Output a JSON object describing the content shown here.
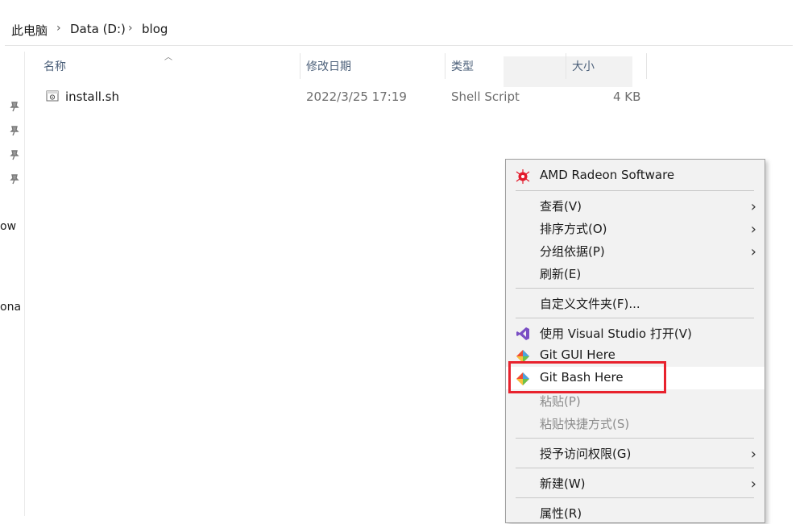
{
  "breadcrumb": {
    "items": [
      "此电脑",
      "Data (D:)",
      "blog"
    ]
  },
  "nav": {
    "fragments": [
      "ow",
      "ona"
    ]
  },
  "columns": {
    "name": "名称",
    "modified": "修改日期",
    "type": "类型",
    "size": "大小"
  },
  "files": [
    {
      "name": "install.sh",
      "modified": "2022/3/25 17:19",
      "type": "Shell Script",
      "size": "4 KB"
    }
  ],
  "context_menu": {
    "amd": "AMD Radeon Software",
    "view": "查看(V)",
    "sort": "排序方式(O)",
    "group": "分组依据(P)",
    "refresh": "刷新(E)",
    "customize": "自定义文件夹(F)...",
    "open_vs": "使用 Visual Studio 打开(V)",
    "git_gui": "Git GUI Here",
    "git_bash": "Git Bash Here",
    "paste": "粘贴(P)",
    "paste_shortcut": "粘贴快捷方式(S)",
    "grant_access": "授予访问权限(G)",
    "new": "新建(W)",
    "properties": "属性(R)"
  },
  "colors": {
    "highlight_box": "#e8222d",
    "header_text": "#4c607a",
    "amd_red": "#e31b2c",
    "vs_purple": "#7a4fc4"
  }
}
